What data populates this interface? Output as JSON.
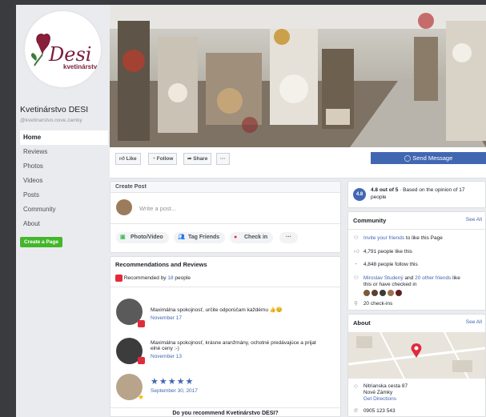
{
  "page": {
    "name": "Kvetinárstvo DESI",
    "handle": "@kvetinarstvo.nove.zamky",
    "logo_main": "Desi",
    "logo_sub": "kvetinárstvo",
    "create_page": "Create a Page"
  },
  "nav": [
    "Home",
    "Reviews",
    "Photos",
    "Videos",
    "Posts",
    "Community",
    "About"
  ],
  "actions": {
    "like": "Like",
    "follow": "Follow",
    "share": "Share",
    "more": "···",
    "send": "Send Message"
  },
  "create_post": {
    "title": "Create Post",
    "placeholder": "Write a post...",
    "photo_video": "Photo/Video",
    "tag_friends": "Tag Friends",
    "check_in": "Check in",
    "more": "···"
  },
  "recommendations": {
    "title": "Recommendations and Reviews",
    "summary_prefix": "Recommended by ",
    "summary_count": "18",
    "summary_suffix": " people",
    "items": [
      {
        "text": "Maximálna spokojnosť, určite odporúčam každému 👍😊",
        "date": "November 17"
      },
      {
        "text": "Maximálna spokojnosť, krásne aranžmány, ochotné predávajúce a prijat",
        "text2": "elné ceny :-)",
        "date": "November 13"
      },
      {
        "stars": "★★★★★",
        "date": "September 30, 2017"
      }
    ],
    "question": "Do you recommend Kvetinárstvo DESI?"
  },
  "rating": {
    "score": "4.8",
    "text_bold": "4.8 out of 5",
    "text": " · Based on the opinion of 17",
    "text2": "people"
  },
  "community": {
    "title": "Community",
    "see_all": "See All",
    "invite_link": "Invite your friends",
    "invite_rest": " to like this Page",
    "likes": "4,791 people like this",
    "follows": "4,848 people follow this",
    "friend_name": "Miroslav Studený",
    "friend_and": " and ",
    "friend_others": "20 other friends",
    "friend_rest": " like",
    "friend_line2": "this or have checked in",
    "checkins": "20 check-ins"
  },
  "about": {
    "title": "About",
    "see_all": "See All",
    "address1": "Nitrianska cesta 87",
    "address2": "Nové Zámky",
    "directions": "Get Directions",
    "phone": "0905 123 543"
  },
  "colors": {
    "fb_blue": "#4267b2",
    "green": "#42b72a",
    "red": "#e02b3c"
  }
}
